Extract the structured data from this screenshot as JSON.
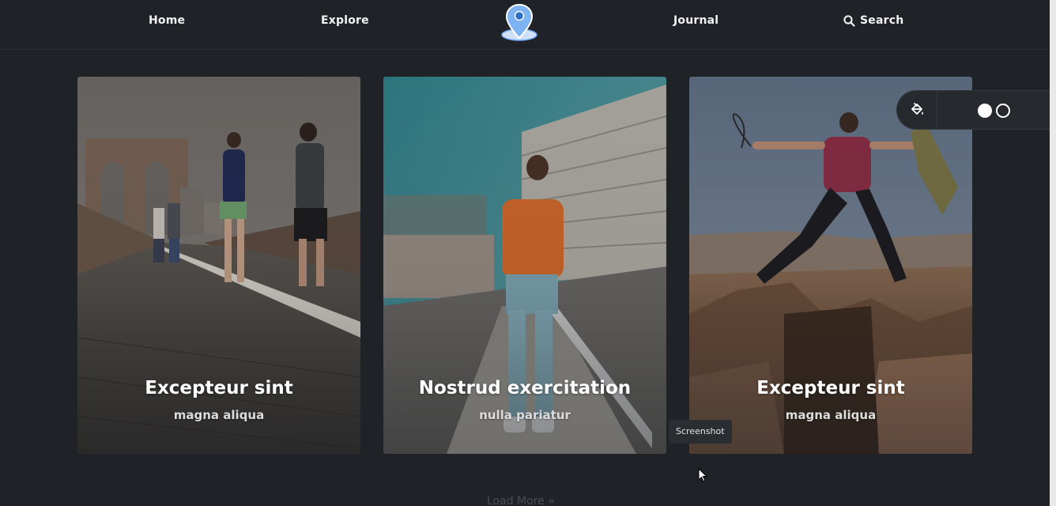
{
  "nav": {
    "home": "Home",
    "explore": "Explore",
    "journal": "Journal",
    "search": "Search",
    "search_icon": "search-icon",
    "logo_icon": "map-pin-icon"
  },
  "cards": [
    {
      "title": "Excepteur sint",
      "subtitle": "magna aliqua"
    },
    {
      "title": "Nostrud exercitation",
      "subtitle": "nulla pariatur"
    },
    {
      "title": "Excepteur sint",
      "subtitle": "magna aliqua"
    }
  ],
  "theme_widget": {
    "paint_icon": "paint-bucket-icon",
    "options": [
      "light",
      "dark"
    ]
  },
  "tooltip": "Screenshot",
  "load_more": "Load More »",
  "colors": {
    "background": "#1f2226",
    "text": "#ffffff",
    "accent_pin": "#6fa8f0"
  }
}
